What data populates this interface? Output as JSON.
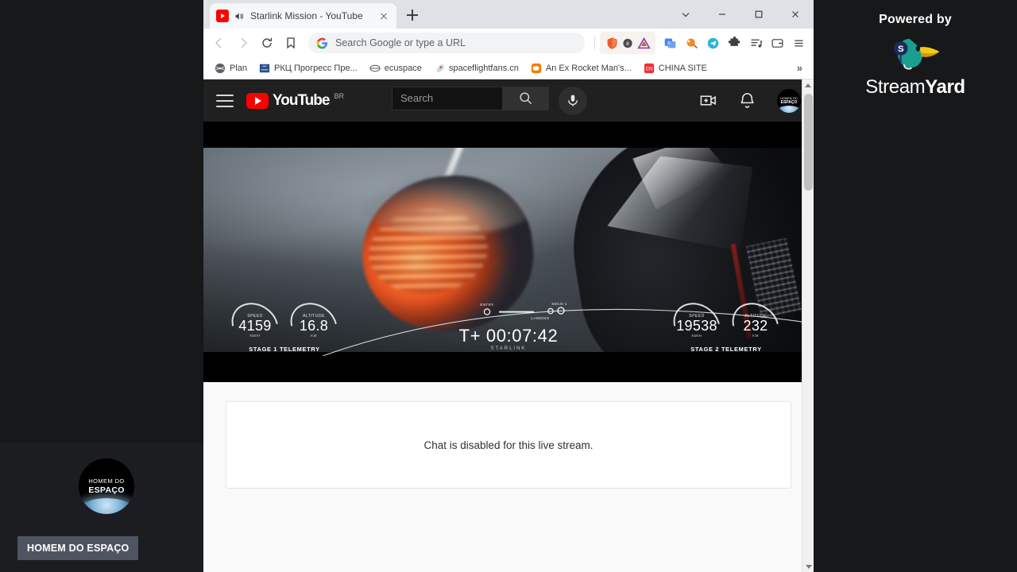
{
  "overlay": {
    "streamyard": {
      "powered_by": "Powered by",
      "brand_first": "Stream",
      "brand_second": "Yard",
      "logo_icon": "duck-icon",
      "badge_letter": "S"
    },
    "presenter": {
      "name_label": "HOMEM DO ESPAÇO",
      "avatar_line1": "HOMEM DO",
      "avatar_line2": "ESPAÇO",
      "avatar_icon": "earth-horizon-avatar"
    }
  },
  "browser": {
    "tabs": [
      {
        "title": "Starlink Mission - YouTube",
        "favicon": "youtube-favicon",
        "audio_icon": "speaker-playing-icon",
        "close_icon": "close-icon"
      }
    ],
    "new_tab_icon": "plus-icon",
    "window_controls": [
      {
        "name": "tab-search-button",
        "icon": "chevron-down-icon"
      },
      {
        "name": "minimize-button",
        "icon": "minimize-icon"
      },
      {
        "name": "maximize-button",
        "icon": "maximize-icon"
      },
      {
        "name": "close-window-button",
        "icon": "close-icon"
      }
    ],
    "toolbar": {
      "back_icon": "back-arrow-icon",
      "forward_icon": "forward-arrow-icon",
      "reload_icon": "reload-icon",
      "bookmark_icon": "bookmark-icon",
      "omnibox_placeholder": "Search Google or type a URL",
      "omnibox_value": "",
      "omnibox_leading_icon": "google-g-icon",
      "extensions": [
        {
          "name": "brave-shields-icon",
          "label": "Brave Shields"
        },
        {
          "name": "brave-rewards-triangle-icon",
          "label": "Brave Rewards"
        },
        {
          "name": "translate-extension-icon",
          "label": "Translate"
        },
        {
          "name": "paint-extension-icon",
          "label": "Color Picker"
        },
        {
          "name": "telegram-extension-icon",
          "label": "Telegram"
        },
        {
          "name": "puzzle-extensions-icon",
          "label": "Extensions"
        },
        {
          "name": "playlist-extension-icon",
          "label": "Playlist"
        },
        {
          "name": "wallet-icon",
          "label": "Wallet"
        },
        {
          "name": "browser-menu-icon",
          "label": "Customize and control"
        }
      ]
    },
    "bookmarks": [
      {
        "label": "Plan",
        "icon": "globe-bookmark-icon"
      },
      {
        "label": "РКЦ Прогресс Пре...",
        "icon": "site-bookmark-icon"
      },
      {
        "label": "ecuspace",
        "icon": "ellipse-bookmark-icon"
      },
      {
        "label": "spaceflightfans.cn",
        "icon": "rocket-bookmark-icon"
      },
      {
        "label": "An Ex Rocket Man's...",
        "icon": "blogger-bookmark-icon"
      },
      {
        "label": "CHINA SITE",
        "icon": "cnsa-bookmark-icon"
      }
    ],
    "bookmarks_overflow_icon": "double-chevron-right-icon",
    "scrollbar": {
      "up_icon": "scroll-up-arrow-icon",
      "down_icon": "scroll-down-arrow-icon"
    }
  },
  "youtube": {
    "masthead": {
      "menu_icon": "hamburger-menu-icon",
      "logo_text": "YouTube",
      "logo_country": "BR",
      "search_placeholder": "Search",
      "search_value": "",
      "search_icon": "search-icon",
      "mic_icon": "microphone-icon",
      "create_icon": "create-video-icon",
      "notifications_icon": "notification-bell-icon",
      "avatar_icon": "channel-avatar",
      "avatar_line1": "HOMEM DO",
      "avatar_line2": "ESPAÇO"
    },
    "chat": {
      "disabled_message": "Chat is disabled for this live stream."
    }
  },
  "telemetry": {
    "stage1": {
      "caption": "STAGE 1 TELEMETRY",
      "speed_label": "SPEED",
      "speed_value": "4159",
      "speed_unit": "KM/H",
      "altitude_label": "ALTITUDE",
      "altitude_value": "16.8",
      "altitude_unit": "KM"
    },
    "stage2": {
      "caption": "STAGE 2 TELEMETRY",
      "speed_label": "SPEED",
      "speed_value": "19538",
      "speed_unit": "KM/H",
      "altitude_label": "ALTITUDE",
      "altitude_value": "232",
      "altitude_unit": "KM"
    },
    "timer": {
      "value": "T+ 00:07:42",
      "mission": "STARLINK"
    },
    "trajectory_markers": [
      {
        "label": "ENTRY"
      },
      {
        "label": "SECO-1"
      },
      {
        "label": "LANDING"
      }
    ]
  },
  "colors": {
    "youtube_red": "#ff0000",
    "brand_dark": "#17181a",
    "flame_orange": "#ff7a33",
    "streamyard_teal": "#1a9e8f"
  }
}
